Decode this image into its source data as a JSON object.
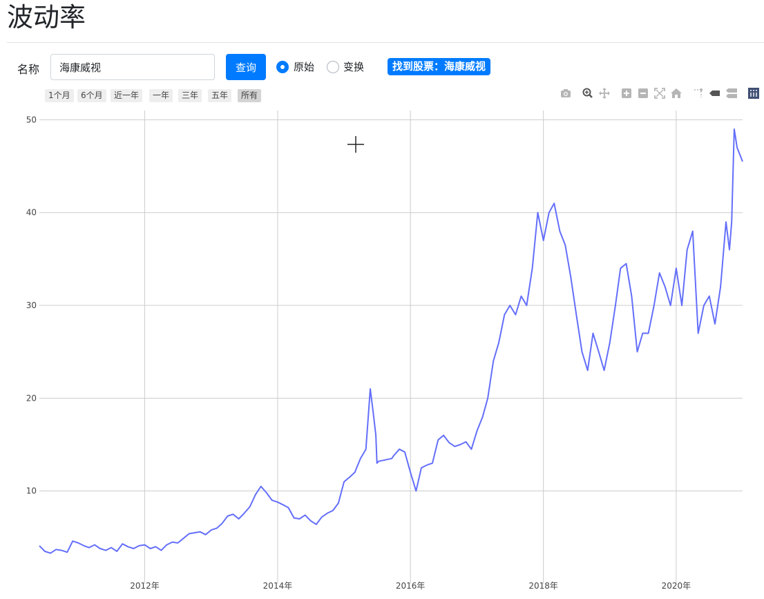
{
  "page": {
    "title": "波动率"
  },
  "form": {
    "name_label": "名称",
    "name_value": "海康威视",
    "query_label": "查询",
    "radio_original": "原始",
    "radio_transform": "变换",
    "selected": "原始",
    "found_badge": "找到股票：海康威视"
  },
  "range_selector": [
    {
      "label": "1个月",
      "active": false
    },
    {
      "label": "6个月",
      "active": false
    },
    {
      "label": "近一年",
      "active": false
    },
    {
      "label": "一年",
      "active": false
    },
    {
      "label": "三年",
      "active": false
    },
    {
      "label": "五年",
      "active": false
    },
    {
      "label": "所有",
      "active": true
    }
  ],
  "modebar": [
    "camera-icon",
    "zoom-icon",
    "pan-icon",
    "zoom-in-icon",
    "zoom-out-icon",
    "autoscale-icon",
    "reset-axes-icon",
    "spike-lines-icon",
    "hover-closest-icon",
    "hover-compare-icon",
    "plotly-logo-icon"
  ],
  "colors": {
    "accent": "#007bff",
    "line": "#636efa",
    "grid": "#cccccc",
    "axis_text": "#444444"
  },
  "chart_data": {
    "type": "line",
    "xlabel": "",
    "ylabel": "",
    "xlim": [
      "2010-06-01",
      "2020-12-31"
    ],
    "ylim": [
      0,
      51
    ],
    "xticks": [
      "2012年",
      "2014年",
      "2016年",
      "2018年",
      "2020年"
    ],
    "xtick_values": [
      "2012-01-01",
      "2014-01-01",
      "2016-01-01",
      "2018-01-01",
      "2020-01-01"
    ],
    "yticks": [
      10,
      20,
      30,
      40,
      50
    ],
    "grid": true,
    "series": [
      {
        "name": "",
        "x": [
          "2010-06-01",
          "2010-07-01",
          "2010-08-01",
          "2010-09-01",
          "2010-10-01",
          "2010-11-01",
          "2010-12-01",
          "2011-01-01",
          "2011-02-01",
          "2011-03-01",
          "2011-04-01",
          "2011-05-01",
          "2011-06-01",
          "2011-07-01",
          "2011-08-01",
          "2011-09-01",
          "2011-10-01",
          "2011-11-01",
          "2011-12-01",
          "2012-01-01",
          "2012-02-01",
          "2012-03-01",
          "2012-04-01",
          "2012-05-01",
          "2012-06-01",
          "2012-07-01",
          "2012-08-01",
          "2012-09-01",
          "2012-10-01",
          "2012-11-01",
          "2012-12-01",
          "2013-01-01",
          "2013-02-01",
          "2013-03-01",
          "2013-04-01",
          "2013-05-01",
          "2013-06-01",
          "2013-07-01",
          "2013-08-01",
          "2013-09-01",
          "2013-10-01",
          "2013-11-01",
          "2013-12-01",
          "2014-01-01",
          "2014-02-01",
          "2014-03-01",
          "2014-04-01",
          "2014-05-01",
          "2014-06-01",
          "2014-07-01",
          "2014-08-01",
          "2014-09-01",
          "2014-10-01",
          "2014-11-01",
          "2014-12-01",
          "2015-01-01",
          "2015-02-01",
          "2015-03-01",
          "2015-04-01",
          "2015-05-01",
          "2015-05-25",
          "2015-06-10",
          "2015-06-25",
          "2015-07-01",
          "2015-07-10",
          "2015-09-20",
          "2015-10-01",
          "2015-11-01",
          "2015-12-01",
          "2016-01-01",
          "2016-02-01",
          "2016-03-01",
          "2016-04-01",
          "2016-05-01",
          "2016-06-01",
          "2016-07-01",
          "2016-08-01",
          "2016-09-01",
          "2016-10-01",
          "2016-11-01",
          "2016-12-01",
          "2017-01-01",
          "2017-02-01",
          "2017-03-01",
          "2017-04-01",
          "2017-05-01",
          "2017-06-01",
          "2017-07-01",
          "2017-08-01",
          "2017-09-01",
          "2017-10-01",
          "2017-11-01",
          "2017-12-01",
          "2018-01-01",
          "2018-02-01",
          "2018-03-01",
          "2018-04-01",
          "2018-05-01",
          "2018-06-01",
          "2018-07-01",
          "2018-08-01",
          "2018-09-01",
          "2018-10-01",
          "2018-11-01",
          "2018-12-01",
          "2019-01-01",
          "2019-02-01",
          "2019-03-01",
          "2019-04-01",
          "2019-05-01",
          "2019-06-01",
          "2019-07-01",
          "2019-08-01",
          "2019-09-01",
          "2019-10-01",
          "2019-11-01",
          "2019-12-01",
          "2020-01-01",
          "2020-02-01",
          "2020-03-01",
          "2020-04-01",
          "2020-05-01",
          "2020-06-01",
          "2020-07-01",
          "2020-08-01",
          "2020-09-01",
          "2020-10-01",
          "2020-10-20",
          "2020-11-01",
          "2020-11-15",
          "2020-12-01",
          "2020-12-31"
        ],
        "values": [
          4.1,
          3.5,
          3.3,
          3.7,
          3.6,
          3.4,
          4.6,
          4.4,
          4.1,
          3.9,
          4.2,
          3.8,
          3.6,
          3.9,
          3.5,
          4.3,
          4.0,
          3.8,
          4.1,
          4.2,
          3.8,
          4.0,
          3.6,
          4.2,
          4.5,
          4.4,
          4.9,
          5.4,
          5.5,
          5.6,
          5.3,
          5.8,
          6.0,
          6.5,
          7.3,
          7.5,
          7.0,
          7.6,
          8.3,
          9.6,
          10.5,
          9.8,
          9.0,
          8.8,
          8.5,
          8.2,
          7.1,
          7.0,
          7.4,
          6.8,
          6.4,
          7.2,
          7.6,
          7.9,
          8.7,
          11.0,
          11.5,
          12.0,
          13.5,
          14.5,
          21.0,
          18.5,
          16.0,
          13.0,
          13.2,
          13.5,
          13.8,
          14.5,
          14.2,
          12.0,
          10.0,
          12.5,
          12.8,
          13.0,
          15.5,
          16.0,
          15.2,
          14.8,
          15.0,
          15.3,
          14.5,
          16.5,
          18.0,
          20.0,
          24.0,
          26.0,
          29.0,
          30.0,
          29.0,
          31.0,
          30.0,
          34.0,
          40.0,
          37.0,
          40.0,
          41.0,
          38.0,
          36.5,
          33.0,
          29.0,
          25.0,
          23.0,
          27.0,
          25.0,
          23.0,
          26.0,
          30.0,
          34.0,
          34.5,
          31.0,
          25.0,
          27.0,
          27.0,
          30.0,
          33.5,
          32.0,
          30.0,
          34.0,
          30.0,
          36.0,
          38.0,
          27.0,
          30.0,
          31.0,
          28.0,
          32.0,
          39.0,
          36.0,
          39.0,
          49.0,
          47.0,
          45.5
        ]
      }
    ]
  }
}
